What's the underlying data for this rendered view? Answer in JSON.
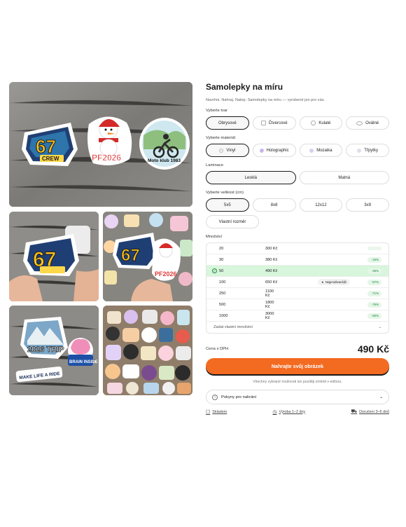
{
  "product": {
    "title": "Samolepky na míru",
    "subtitle": "Navrhni. Nahraj. Nalep. Samolepky na míru — vyrobené jen pro vás."
  },
  "gallery": {
    "main_sticker_1": "67",
    "main_sticker_1b": "CREW",
    "main_sticker_2": "PF2026",
    "main_sticker_3": "Moto klub 1983",
    "sticker_trip": "2026 TRIP",
    "sticker_make": "MAKE LIFE A RIDE",
    "sticker_brain": "BRAIN INSIDE"
  },
  "shape": {
    "label": "Vyberte tvar",
    "options": [
      "Obrysové",
      "Čtvercové",
      "Kulaté",
      "Oválné"
    ]
  },
  "material": {
    "label": "Vyberte materiál",
    "options": [
      "Vinyl",
      "Holographic",
      "Mozaika",
      "Třpytky"
    ]
  },
  "lamination": {
    "label": "Laminace",
    "options": [
      "Lesklá",
      "Matná"
    ]
  },
  "size": {
    "label": "Vyberte velikost (cm)",
    "options": [
      "5x5",
      "8x8",
      "12x12",
      "3x9"
    ],
    "custom": "Vlastní rozměr"
  },
  "quantity": {
    "label": "Množství",
    "rows": [
      {
        "q": "20",
        "p": "300 Kč",
        "disc": ""
      },
      {
        "q": "30",
        "p": "380 Kč",
        "disc": "-16%"
      },
      {
        "q": "50",
        "p": "490 Kč",
        "disc": "-35%"
      },
      {
        "q": "100",
        "p": "650 Kč",
        "disc": "-57%"
      },
      {
        "q": "250",
        "p": "1100 Kč",
        "disc": "-71%"
      },
      {
        "q": "500",
        "p": "1800 Kč",
        "disc": "-76%"
      },
      {
        "q": "1000",
        "p": "3000 Kč",
        "disc": "-80%"
      }
    ],
    "badge": "Nejprodávanější",
    "custom": "Zadat vlastní množství"
  },
  "price": {
    "label": "Cena s DPH",
    "value": "490 Kč"
  },
  "cta": "Nahrajte svůj obrázek",
  "note": "Všechny vybrané možnosti lze později změnit v editoru.",
  "info": "Pokyny pro nahrání",
  "footer": {
    "stock": "Skladem",
    "production": "Výroba 1–2 dny",
    "delivery": "Doručení 3–6 dnů"
  },
  "colors": {
    "accent": "#f36a21",
    "selected_row": "#d7f6dc",
    "discount": "#1c8a3d"
  }
}
